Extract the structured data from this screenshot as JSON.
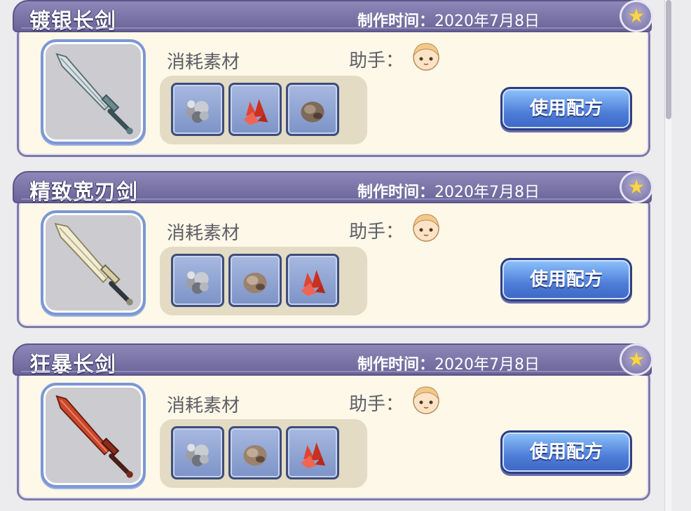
{
  "recipes": [
    {
      "name": "镀银长剑",
      "time_label": "制作时间：",
      "time_value": "2020年7月8日",
      "materials_label": "消耗素材",
      "helper_label": "助手：",
      "button_label": "使用配方",
      "blade_color": "#cfd8d8",
      "materials": [
        "grey-ore-icon",
        "red-crystal-icon",
        "brown-ore-icon"
      ]
    },
    {
      "name": "精致宽刃剑",
      "time_label": "制作时间：",
      "time_value": "2020年7月8日",
      "materials_label": "消耗素材",
      "helper_label": "助手：",
      "button_label": "使用配方",
      "blade_color": "#efe9cf",
      "materials": [
        "grey-ore-icon",
        "brown-ore-icon",
        "red-crystal-icon"
      ]
    },
    {
      "name": "狂暴长剑",
      "time_label": "制作时间：",
      "time_value": "2020年7月8日",
      "materials_label": "消耗素材",
      "helper_label": "助手：",
      "button_label": "使用配方",
      "blade_color": "#c9472c",
      "materials": [
        "grey-ore-icon",
        "brown-ore-icon",
        "red-crystal-icon"
      ]
    }
  ],
  "colors": {
    "header": "#6a6498",
    "card_bg": "#fdf8e8",
    "button": "#4e7ed9",
    "star": "#f7d54c"
  },
  "icons": {
    "favorite": "star-icon",
    "helper": "helper-avatar-icon"
  }
}
